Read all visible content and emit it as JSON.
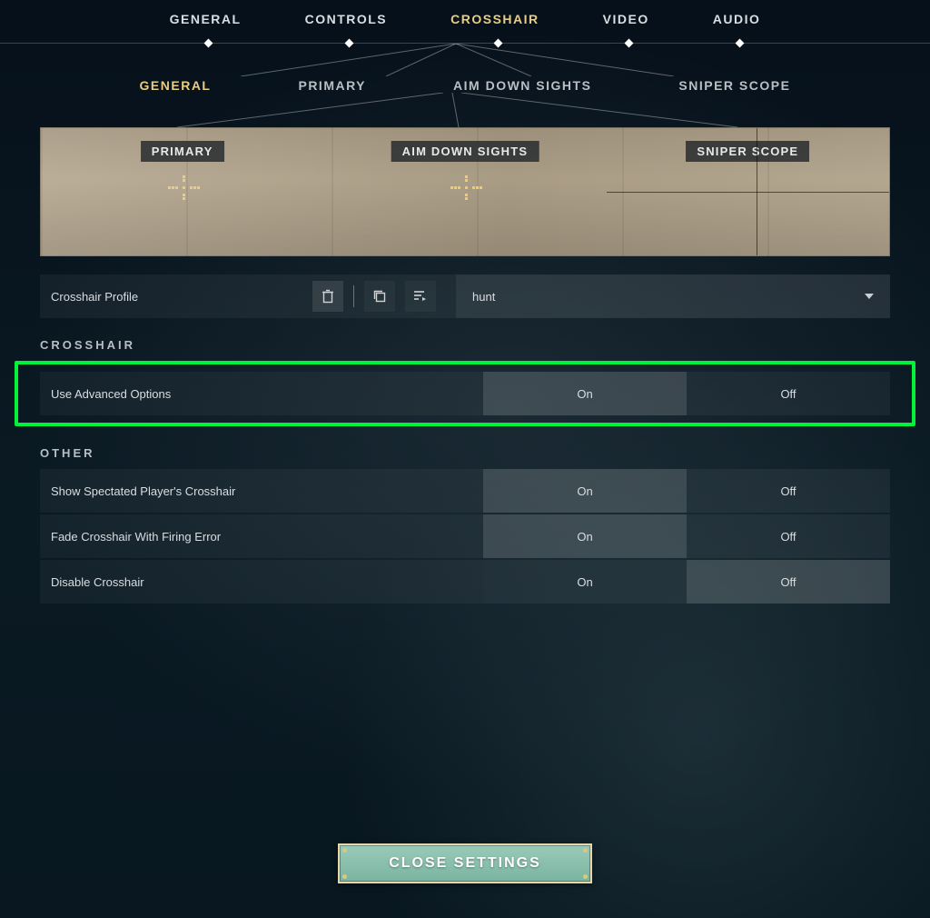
{
  "topnav": {
    "items": [
      {
        "label": "GENERAL"
      },
      {
        "label": "CONTROLS"
      },
      {
        "label": "CROSSHAIR",
        "active": true
      },
      {
        "label": "VIDEO"
      },
      {
        "label": "AUDIO"
      }
    ]
  },
  "subnav": {
    "items": [
      {
        "label": "GENERAL",
        "active": true
      },
      {
        "label": "PRIMARY"
      },
      {
        "label": "AIM DOWN SIGHTS"
      },
      {
        "label": "SNIPER SCOPE"
      }
    ]
  },
  "preview": {
    "labels": [
      "PRIMARY",
      "AIM DOWN SIGHTS",
      "SNIPER SCOPE"
    ]
  },
  "profile": {
    "label": "Crosshair Profile",
    "selected": "hunt"
  },
  "sections": {
    "crosshair": {
      "title": "CROSSHAIR",
      "options": [
        {
          "label": "Use Advanced Options",
          "on": "On",
          "off": "Off",
          "value": "On",
          "highlighted": true
        }
      ]
    },
    "other": {
      "title": "OTHER",
      "options": [
        {
          "label": "Show Spectated Player's Crosshair",
          "on": "On",
          "off": "Off",
          "value": "On"
        },
        {
          "label": "Fade Crosshair With Firing Error",
          "on": "On",
          "off": "Off",
          "value": "On"
        },
        {
          "label": "Disable Crosshair",
          "on": "On",
          "off": "Off",
          "value": "Off"
        }
      ]
    }
  },
  "close": {
    "label": "CLOSE SETTINGS"
  }
}
